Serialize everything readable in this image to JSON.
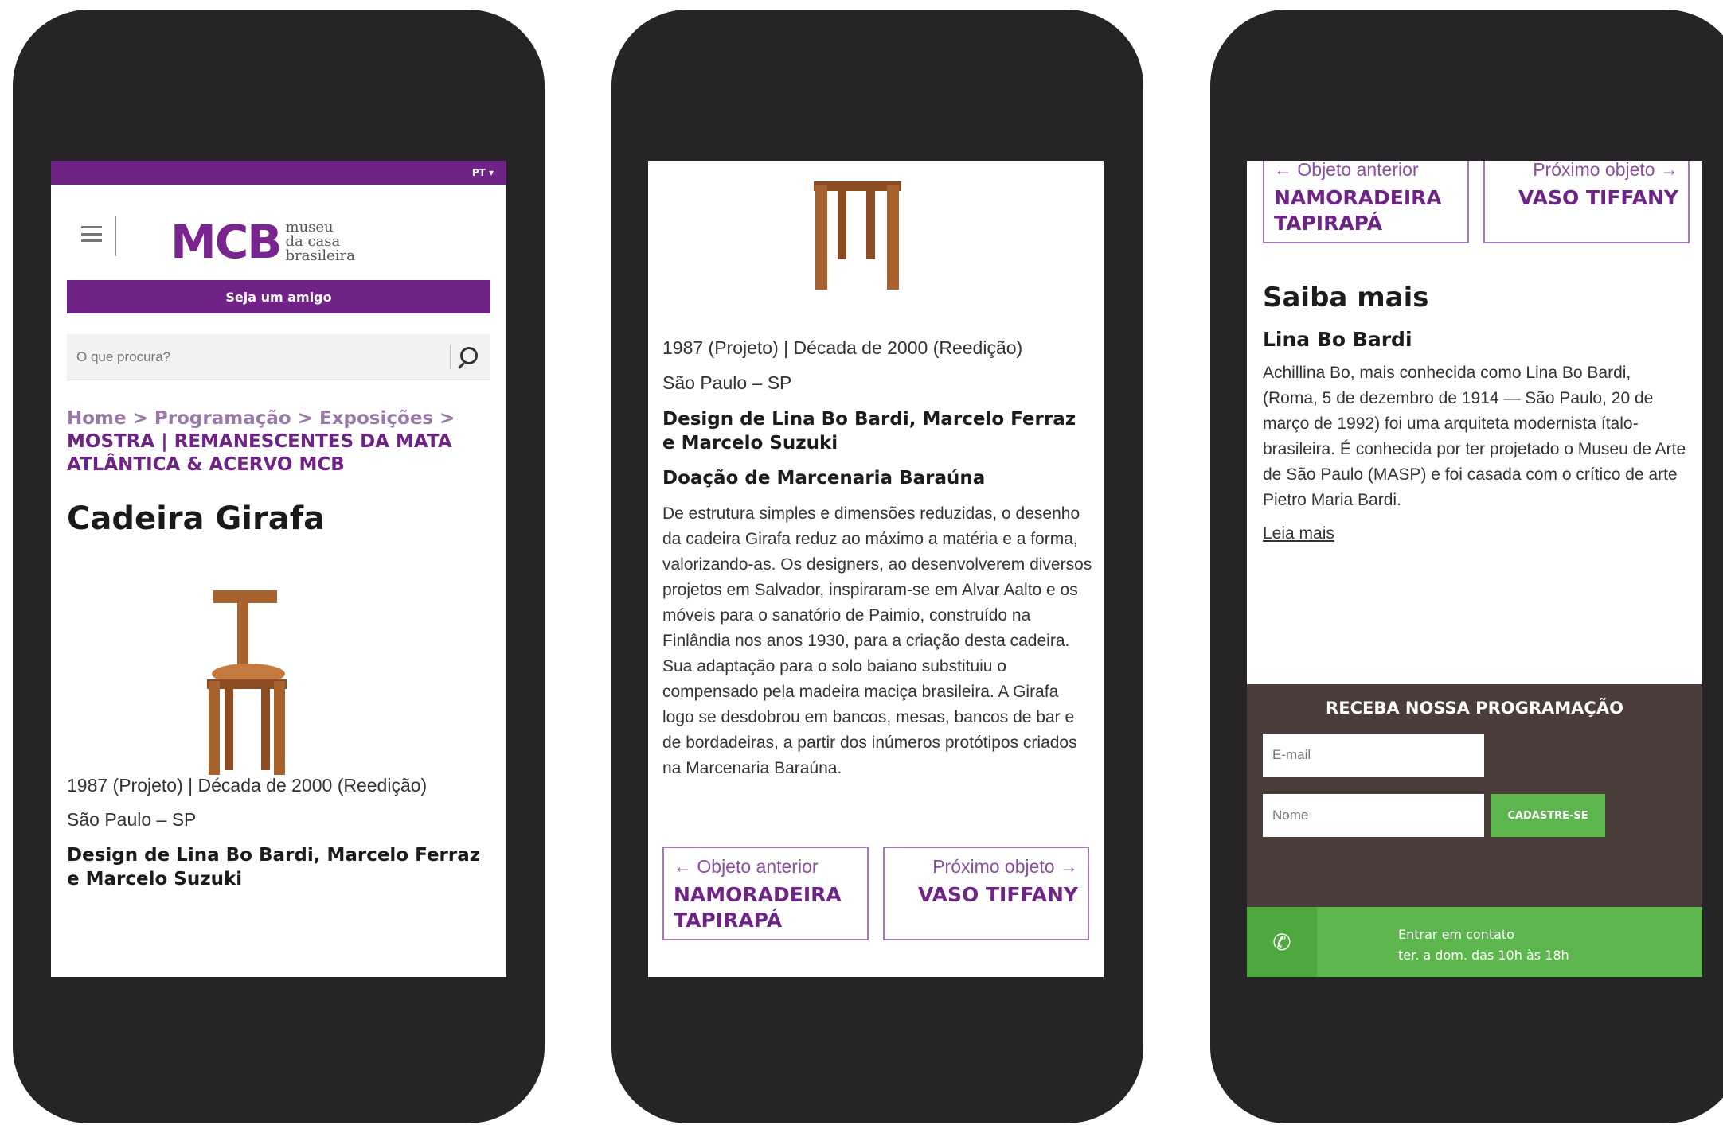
{
  "header": {
    "lang": "PT ▾",
    "logo_mark": "MCB",
    "logo_line1": "museu",
    "logo_line2": "da casa",
    "logo_line3": "brasileira",
    "friend_button": "Seja um amigo",
    "search_placeholder": "O que procura?"
  },
  "breadcrumb": {
    "home": "Home",
    "sep": " > ",
    "programacao": "Programação",
    "exposicoes": "Exposições",
    "current": "MOSTRA | REMANESCENTES DA MATA ATLÂNTICA & ACERVO MCB"
  },
  "object": {
    "title": "Cadeira Girafa",
    "date": "1987 (Projeto) | Década de 2000 (Reedição)",
    "place": "São Paulo – SP",
    "design": "Design de Lina Bo Bardi, Marcelo Ferraz e Marcelo Suzuki",
    "donation": "Doação de Marcenaria Baraúna",
    "description": "De estrutura simples e dimensões reduzidas, o desenho da cadeira Girafa reduz ao máximo a matéria e a forma, valorizando-as. Os designers, ao desenvolverem diversos projetos em Salvador, inspiraram-se em Alvar Aalto e os móveis para o sanatório de Paimio, construído na Finlândia nos anos 1930, para a criação desta cadeira. Sua adaptação para o solo baiano substituiu o compensado pela madeira maciça brasileira. A Girafa logo se desdobrou em bancos, mesas, bancos de bar e de bordadeiras, a partir dos inúmeros protótipos criados na Marcenaria Baraúna."
  },
  "navigation": {
    "prev_label": "← Objeto anterior",
    "prev_title": "NAMORADEIRA TAPIRAPÁ",
    "next_label": "Próximo objeto →",
    "next_title": "VASO TIFFANY"
  },
  "saiba_mais": {
    "heading": "Saiba mais",
    "name": "Lina Bo Bardi",
    "bio": "Achillina Bo, mais conhecida como Lina Bo Bardi, (Roma, 5 de dezembro de 1914 — São Paulo, 20 de março de 1992) foi uma arquiteta modernista ítalo-brasileira. É conhecida por ter projetado o Museu de Arte de São Paulo (MASP) e foi casada com o crítico de arte Pietro Maria Bardi.",
    "read_more": "Leia mais"
  },
  "newsletter": {
    "title": "RECEBA NOSSA PROGRAMAÇÃO",
    "email_placeholder": "E-mail",
    "name_placeholder": "Nome",
    "submit": "CADASTRE-SE"
  },
  "contact": {
    "line1": "Entrar em contato",
    "line2": "ter. a dom. das 10h às 18h"
  },
  "colors": {
    "brand_purple": "#6f2387",
    "newsletter_bg": "#4b3d39",
    "contact_green": "#5db64d",
    "phone_frame": "#262427"
  }
}
